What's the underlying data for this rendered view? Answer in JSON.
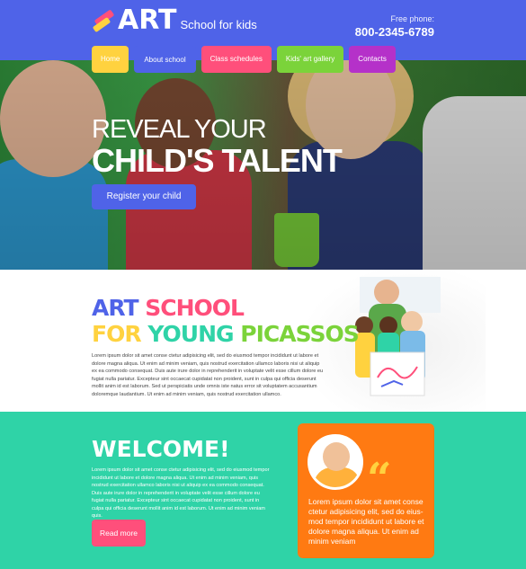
{
  "header": {
    "logo_word": "ART",
    "logo_tagline": "School for kids",
    "phone_label": "Free phone:",
    "phone_number": "800-2345-6789"
  },
  "nav": {
    "items": [
      {
        "label": "Home"
      },
      {
        "label": "About school"
      },
      {
        "label": "Class schedules"
      },
      {
        "label": "Kids' art gallery"
      },
      {
        "label": "Contacts"
      }
    ]
  },
  "hero": {
    "title_line1": "REVEAL YOUR",
    "title_line2": "CHILD'S TALENT",
    "register_label": "Register your child"
  },
  "art_section": {
    "word_art": "ART",
    "word_school": "SCHOOL",
    "word_for": "FOR",
    "word_young": "YOUNG",
    "word_picassos": "PICASSOS",
    "text": "Lorem ipsum dolor sit amet conse ctetur adipisicing elit, sed do eiusmod tempor incididunt ut labore et dolore magna aliqua. Ut enim ad minim veniam, quis nostrud exercitation ullamco laboris nisi ut aliquip ex ea commodo consequat. Duis aute irure dolor in reprehenderit in voluptate velit esse cillum dolore eu fugiat nulla pariatur. Excepteur sint occaecat cupidatat non proident, sunt in culpa qui officia deserunt mollit anim id est laborum. Sed ut perspiciatis unde omnis iste natus error sit voluptatem accusantium doloremque laudantium. Ut enim ad minim veniam, quis nostrud exercitation ullamco."
  },
  "welcome": {
    "title": "WELCOME!",
    "text": "Lorem ipsum dolor sit amet conse ctetur adipisicing elit, sed do eiusmod tempor incididunt ut labore et dolore magna aliqua. Ut enim ad minim veniam, quis nostrud exercitation ullamco laboris nisi ut aliquip ex ea commodo consequat. Duis aute irure dolor in reprehenderit in voluptate velit esse cillum dolore eu fugiat nulla pariatur. Excepteur sint occaecat cupidatat non proident, sunt in culpa qui officia deserunt mollit anim id est laborum. Ut enim ad minim veniam quis.",
    "readmore_label": "Read more"
  },
  "testimonial": {
    "quote_mark": "“",
    "text": "Lorem ipsum dolor sit amet conse ctetur adipisicing elit, sed do eius-mod tempor incididunt ut labore et dolore magna aliqua. Ut enim ad minim veniam"
  },
  "colors": {
    "blue": "#4f63e8",
    "yellow": "#ffd23f",
    "pink": "#ff4f7b",
    "green": "#7bd33a",
    "purple": "#b531c9",
    "teal": "#2fd3a7",
    "orange": "#ff7a12"
  }
}
